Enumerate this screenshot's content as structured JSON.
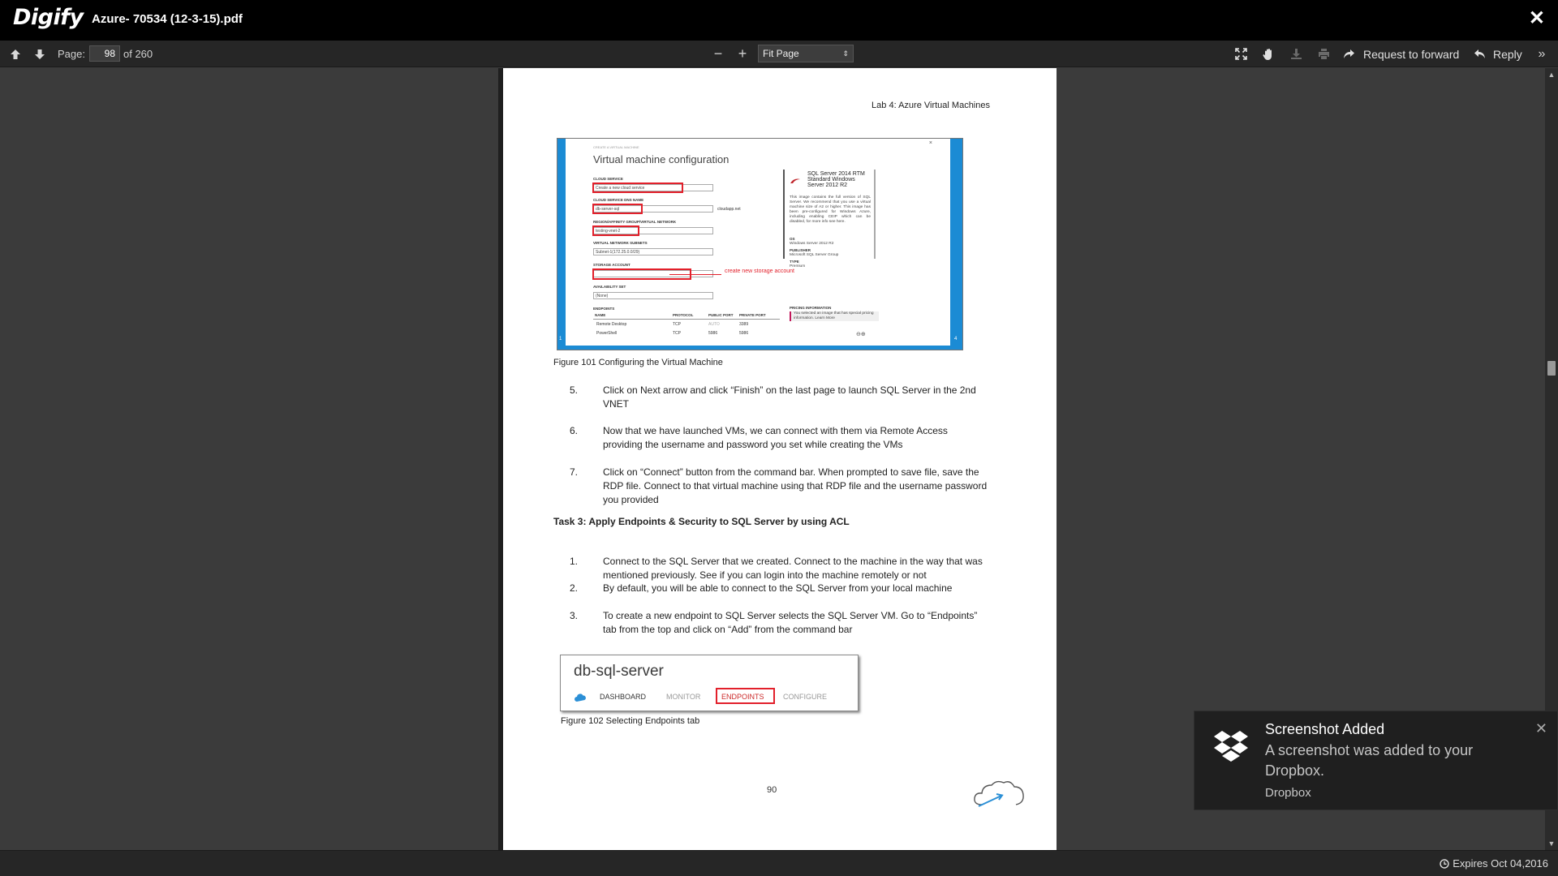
{
  "app": {
    "logo": "Digify",
    "document_title": "Azure- 70534 (12-3-15).pdf"
  },
  "toolbar": {
    "page_label": "Page:",
    "page_value": "98",
    "page_total": "of 260",
    "zoom_out": "−",
    "zoom_in": "+",
    "zoom_value": "Fit Page",
    "request_forward": "Request to forward",
    "reply": "Reply"
  },
  "document_page": {
    "header": "Lab 4: Azure Virtual Machines",
    "figure1": {
      "heading_small": "CREATE A VIRTUAL MACHINE",
      "title": "Virtual machine configuration",
      "cloud_service_label": "CLOUD SERVICE",
      "cloud_service_value": "Create a new cloud service",
      "dns_label": "CLOUD SERVICE DNS NAME",
      "dns_value": "db-server-sql",
      "dns_suffix": "cloudapp.net",
      "region_label": "REGION/AFFINITY GROUP/VIRTUAL NETWORK",
      "region_value": "testing-vnet-2",
      "subnet_label": "VIRTUAL NETWORK SUBNETS",
      "subnet_value": "Subnet-1(172.25.0.0/29)",
      "storage_label": "STORAGE ACCOUNT",
      "storage_value": "",
      "annotation": "create new storage account",
      "availability_label": "AVAILABILITY SET",
      "availability_value": "(None)",
      "endpoints_label": "ENDPOINTS",
      "endpoint_headers": [
        "NAME",
        "PROTOCOL",
        "PUBLIC PORT",
        "PRIVATE PORT"
      ],
      "endpoint_rows": [
        [
          "Remote Desktop",
          "TCP",
          "AUTO",
          "3389"
        ],
        [
          "PowerShell",
          "TCP",
          "5986",
          "5986"
        ]
      ],
      "side_title": "SQL Server 2014 RTM Standard Windows Server 2012 R2",
      "side_desc": "This image contains the full version of SQL Server. We recommend that you use a virtual machine size of A2 or higher. This image has been pre-configured for Windows Azure, including enabling CEIP which can be disabled, for more info see here.",
      "os_label": "OS",
      "os_value": "Windows Server 2012 R2",
      "publisher_label": "PUBLISHER",
      "publisher_value": "Microsoft SQL Server Group",
      "type_label": "TYPE",
      "type_value": "Premium",
      "pricing_label": "PRICING INFORMATION",
      "pricing_text": "You selected an image that has special pricing information. Learn More",
      "step_left_1": "1",
      "step_left_2": "2",
      "step_right": "4"
    },
    "caption1": "Figure 101 Configuring the Virtual Machine",
    "steps_a": [
      {
        "num": "5.",
        "line1": "Click on Next arrow and click “Finish” on the last page to launch SQL Server in the 2nd",
        "line2": "VNET"
      },
      {
        "num": "6.",
        "line1": "Now that we have launched VMs, we can connect with them via Remote Access",
        "line2": "providing the username and password you set while creating the VMs"
      },
      {
        "num": "7.",
        "line1": "Click on “Connect” button from the command bar. When prompted to save file, save the",
        "line2": "RDP file. Connect to that virtual machine using that RDP file and the username password",
        "line3": "you provided"
      }
    ],
    "task_heading": "Task 3: Apply Endpoints & Security to SQL Server by using ACL",
    "steps_b": [
      {
        "num": "1.",
        "line1": "Connect to the SQL Server that we created. Connect to the machine in the way that was",
        "line2": "mentioned previously. See if you can login into the machine remotely or not"
      },
      {
        "num": "2.",
        "line1": "By default, you will be able to connect to the SQL Server from your local machine"
      },
      {
        "num": "3.",
        "line1": "To create a new endpoint to SQL Server selects the SQL Server VM. Go to “Endpoints”",
        "line2": "tab from the top and click on “Add” from the command bar"
      }
    ],
    "figure2": {
      "title": "db-sql-server",
      "tabs": [
        "DASHBOARD",
        "MONITOR",
        "ENDPOINTS",
        "CONFIGURE"
      ]
    },
    "caption2": "Figure 102 Selecting Endpoints tab",
    "page_number": "90"
  },
  "status": {
    "expires": "Expires Oct 04,2016"
  },
  "toast": {
    "title": "Screenshot Added",
    "message": "A screenshot was added to your Dropbox.",
    "source": "Dropbox"
  }
}
